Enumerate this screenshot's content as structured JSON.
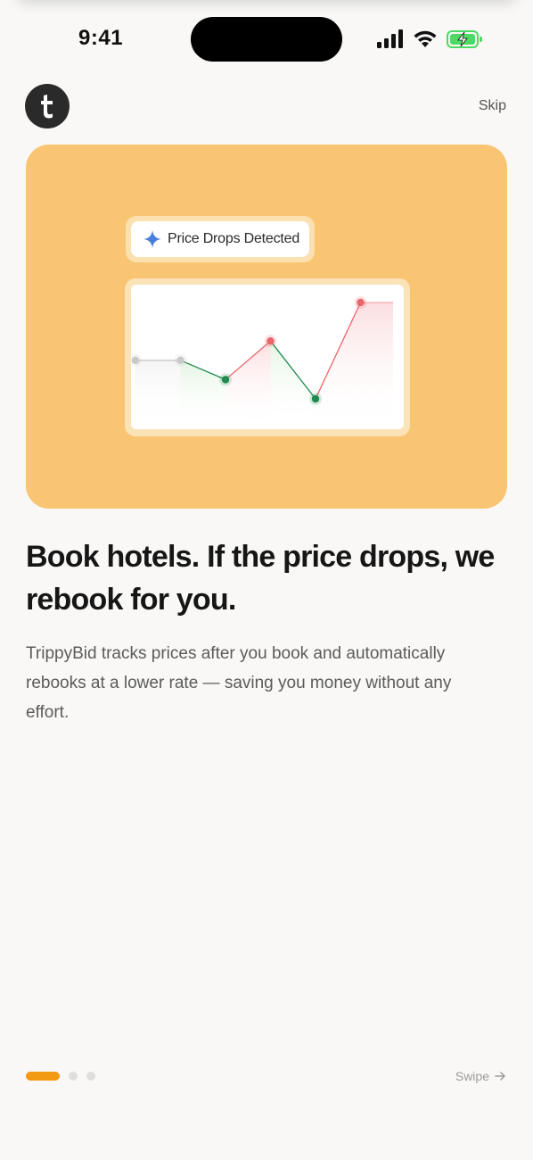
{
  "status_bar": {
    "time": "9:41",
    "icons": [
      "signal-icon",
      "wifi-icon",
      "battery-charging-icon"
    ],
    "battery_color": "#4cd964"
  },
  "header": {
    "logo_letter": "t",
    "skip_label": "Skip"
  },
  "hero": {
    "background": "#f9c572",
    "badge_label": "Price Drops Detected",
    "badge_icon": "sparkle-icon",
    "chart_data": {
      "type": "line",
      "values": [
        3,
        3,
        2,
        4,
        1,
        6
      ],
      "point_states": [
        "neutral",
        "neutral",
        "drop",
        "rise",
        "drop",
        "rise"
      ],
      "colors": {
        "neutral": "#c8c8c8",
        "drop": "#1e8a4f",
        "rise": "#e8656b"
      }
    }
  },
  "content": {
    "headline": "Book hotels. If the price drops, we rebook for you.",
    "body": "TrippyBid tracks prices after you book and automatically rebooks at a lower rate — saving you money without any effort."
  },
  "pager": {
    "total": 3,
    "active": 0,
    "active_color": "#f39a14"
  },
  "swipe_label": "Swipe"
}
